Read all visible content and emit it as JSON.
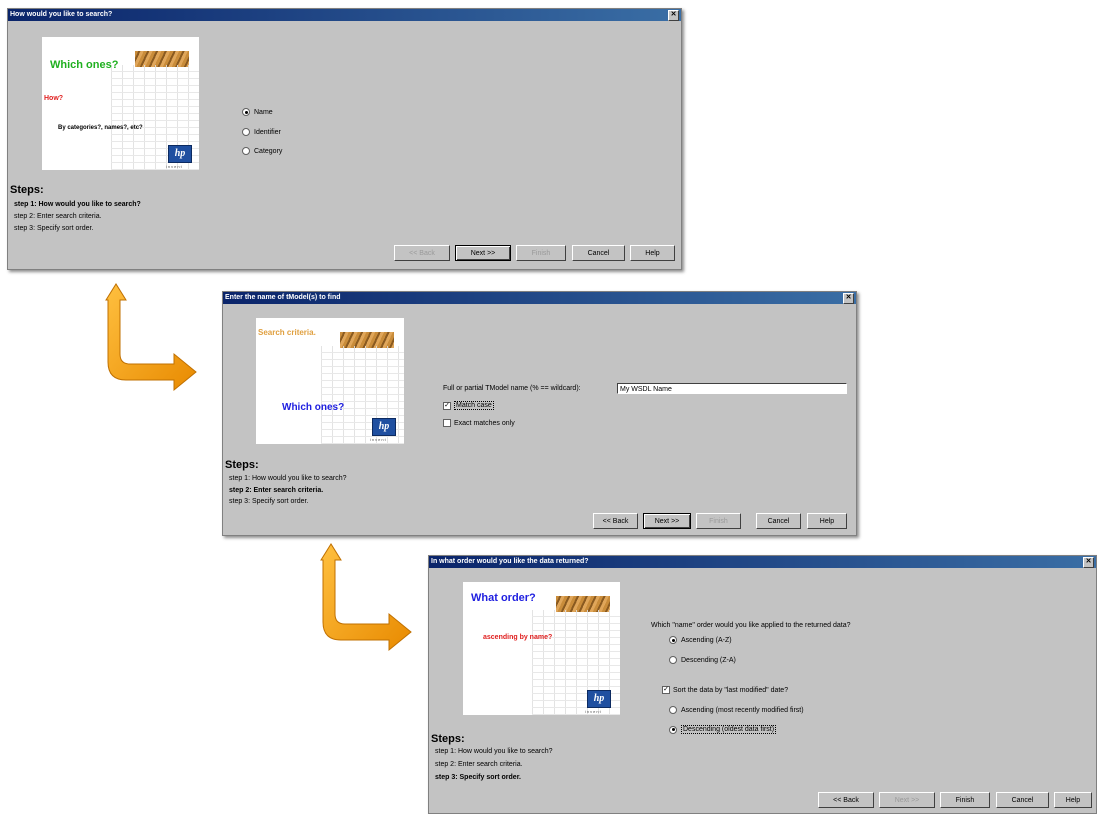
{
  "dialog1": {
    "title": "How would you like to search?",
    "graphic": {
      "line1": "Which ones?",
      "line2": "How?",
      "line3": "By categories?, names?, etc?"
    },
    "options": [
      "Name",
      "Identifier",
      "Category"
    ],
    "selected_option": "Name",
    "steps_heading": "Steps:",
    "steps": [
      "step 1: How would you like to search?",
      "step 2: Enter search criteria.",
      "step 3: Specify sort order."
    ],
    "active_step": 0,
    "buttons": {
      "back": "<< Back",
      "next": "Next >>",
      "finish": "Finish",
      "cancel": "Cancel",
      "help": "Help"
    }
  },
  "dialog2": {
    "title": "Enter the name of tModel(s) to find",
    "graphic": {
      "line1": "Search criteria.",
      "line2": "Which ones?"
    },
    "name_label": "Full or partial TModel name (% == wildcard):",
    "name_value": "My WSDL Name",
    "match_case_label": "Match case",
    "match_case_checked": true,
    "exact_label": "Exact matches only",
    "exact_checked": false,
    "steps_heading": "Steps:",
    "steps": [
      "step 1: How would you like to search?",
      "step 2: Enter search criteria.",
      "step 3: Specify sort order."
    ],
    "active_step": 1,
    "buttons": {
      "back": "<< Back",
      "next": "Next >>",
      "finish": "Finish",
      "cancel": "Cancel",
      "help": "Help"
    }
  },
  "dialog3": {
    "title": "In what order would you like the data returned?",
    "graphic": {
      "line1": "What order?",
      "line2": "ascending by name?"
    },
    "question": "Which \"name\" order would you like applied to the returned data?",
    "name_orders": [
      "Ascending (A-Z)",
      "Descending (Z-A)"
    ],
    "name_order_selected": "Ascending (A-Z)",
    "sort_modified_label": "Sort the data by \"last modified\" date?",
    "sort_modified_checked": true,
    "date_orders": [
      "Ascending (most recently modified first)",
      "Descending (oldest data first)"
    ],
    "date_order_selected": "Descending (oldest data first)",
    "steps_heading": "Steps:",
    "steps": [
      "step 1: How would you like to search?",
      "step 2: Enter search criteria.",
      "step 3: Specify sort order."
    ],
    "active_step": 2,
    "buttons": {
      "back": "<< Back",
      "next": "Next >>",
      "finish": "Finish",
      "cancel": "Cancel",
      "help": "Help"
    }
  },
  "colors": {
    "dialog_bg": "#c3c3c3",
    "titlebar": "#0a246a",
    "arrow": "#f5a100",
    "green": "#20b020",
    "red": "#e02020",
    "blue": "#2020e0",
    "orange_text": "#e0a040"
  },
  "icons": {
    "close": "close-icon",
    "logo": "hp-logo",
    "arrow": "orange-arrow-icon"
  }
}
